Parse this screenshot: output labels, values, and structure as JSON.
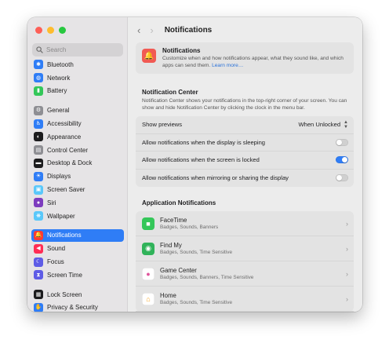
{
  "window": {
    "title": "Notifications"
  },
  "search": {
    "placeholder": "Search"
  },
  "sidebar": {
    "items": [
      {
        "label": "Bluetooth",
        "icon": "bluetooth-icon",
        "color": "#2f7df6",
        "glyph": "✱",
        "active": false
      },
      {
        "label": "Network",
        "icon": "globe-icon",
        "color": "#2f7df6",
        "glyph": "◍",
        "active": false
      },
      {
        "label": "Battery",
        "icon": "battery-icon",
        "color": "#34c759",
        "glyph": "▮",
        "active": false
      },
      {
        "gap": true
      },
      {
        "label": "General",
        "icon": "gear-icon",
        "color": "#8e8e93",
        "glyph": "⚙",
        "active": false
      },
      {
        "label": "Accessibility",
        "icon": "accessibility-icon",
        "color": "#2f7df6",
        "glyph": "♿",
        "active": false
      },
      {
        "label": "Appearance",
        "icon": "appearance-icon",
        "color": "#1c1c1e",
        "glyph": "◐",
        "active": false
      },
      {
        "label": "Control Center",
        "icon": "control-center-icon",
        "color": "#8e8e93",
        "glyph": "▤",
        "active": false
      },
      {
        "label": "Desktop & Dock",
        "icon": "dock-icon",
        "color": "#1c1c1e",
        "glyph": "▬",
        "active": false
      },
      {
        "label": "Displays",
        "icon": "displays-icon",
        "color": "#2f7df6",
        "glyph": "☀",
        "active": false
      },
      {
        "label": "Screen Saver",
        "icon": "screen-saver-icon",
        "color": "#5ac8fa",
        "glyph": "▣",
        "active": false
      },
      {
        "label": "Siri",
        "icon": "siri-icon",
        "color": "#7d3cbe",
        "glyph": "●",
        "active": false
      },
      {
        "label": "Wallpaper",
        "icon": "wallpaper-icon",
        "color": "#5ac8fa",
        "glyph": "❋",
        "active": false
      },
      {
        "gap": true
      },
      {
        "label": "Notifications",
        "icon": "bell-icon",
        "color": "#ff3b30",
        "glyph": "🔔",
        "active": true
      },
      {
        "label": "Sound",
        "icon": "speaker-icon",
        "color": "#ff2d55",
        "glyph": "◀",
        "active": false
      },
      {
        "label": "Focus",
        "icon": "moon-icon",
        "color": "#5e5ce6",
        "glyph": "☾",
        "active": false
      },
      {
        "label": "Screen Time",
        "icon": "hourglass-icon",
        "color": "#5e5ce6",
        "glyph": "⧗",
        "active": false
      },
      {
        "gap": true
      },
      {
        "label": "Lock Screen",
        "icon": "lock-screen-icon",
        "color": "#1c1c1e",
        "glyph": "▦",
        "active": false
      },
      {
        "label": "Privacy & Security",
        "icon": "hand-icon",
        "color": "#2f7df6",
        "glyph": "✋",
        "active": false
      }
    ]
  },
  "header": {
    "title": "Notifications",
    "description": "Customize when and how notifications appear, what they sound like, and which apps can send them.",
    "link": "Learn more…",
    "icon": "bell-icon"
  },
  "notification_center": {
    "title": "Notification Center",
    "description": "Notification Center shows your notifications in the top-right corner of your screen. You can show and hide Notification Center by clicking the clock in the menu bar.",
    "show_previews_label": "Show previews",
    "show_previews_value": "When Unlocked",
    "toggles": [
      {
        "label": "Allow notifications when the display is sleeping",
        "on": false
      },
      {
        "label": "Allow notifications when the screen is locked",
        "on": true
      },
      {
        "label": "Allow notifications when mirroring or sharing the display",
        "on": false
      }
    ]
  },
  "app_notifications": {
    "title": "Application Notifications",
    "apps": [
      {
        "name": "FaceTime",
        "detail": "Badges, Sounds, Banners",
        "icon": "facetime-icon",
        "color": "#34c759",
        "glyph": "■"
      },
      {
        "name": "Find My",
        "detail": "Badges, Sounds, Time Sensitive",
        "icon": "find-my-icon",
        "color": "#30b35a",
        "glyph": "◉"
      },
      {
        "name": "Game Center",
        "detail": "Badges, Sounds, Banners, Time Sensitive",
        "icon": "game-center-icon",
        "color": "#ffffff",
        "glyph": "●"
      },
      {
        "name": "Home",
        "detail": "Badges, Sounds, Time Sensitive",
        "icon": "home-icon",
        "color": "#ffffff",
        "glyph": "⌂"
      }
    ]
  }
}
